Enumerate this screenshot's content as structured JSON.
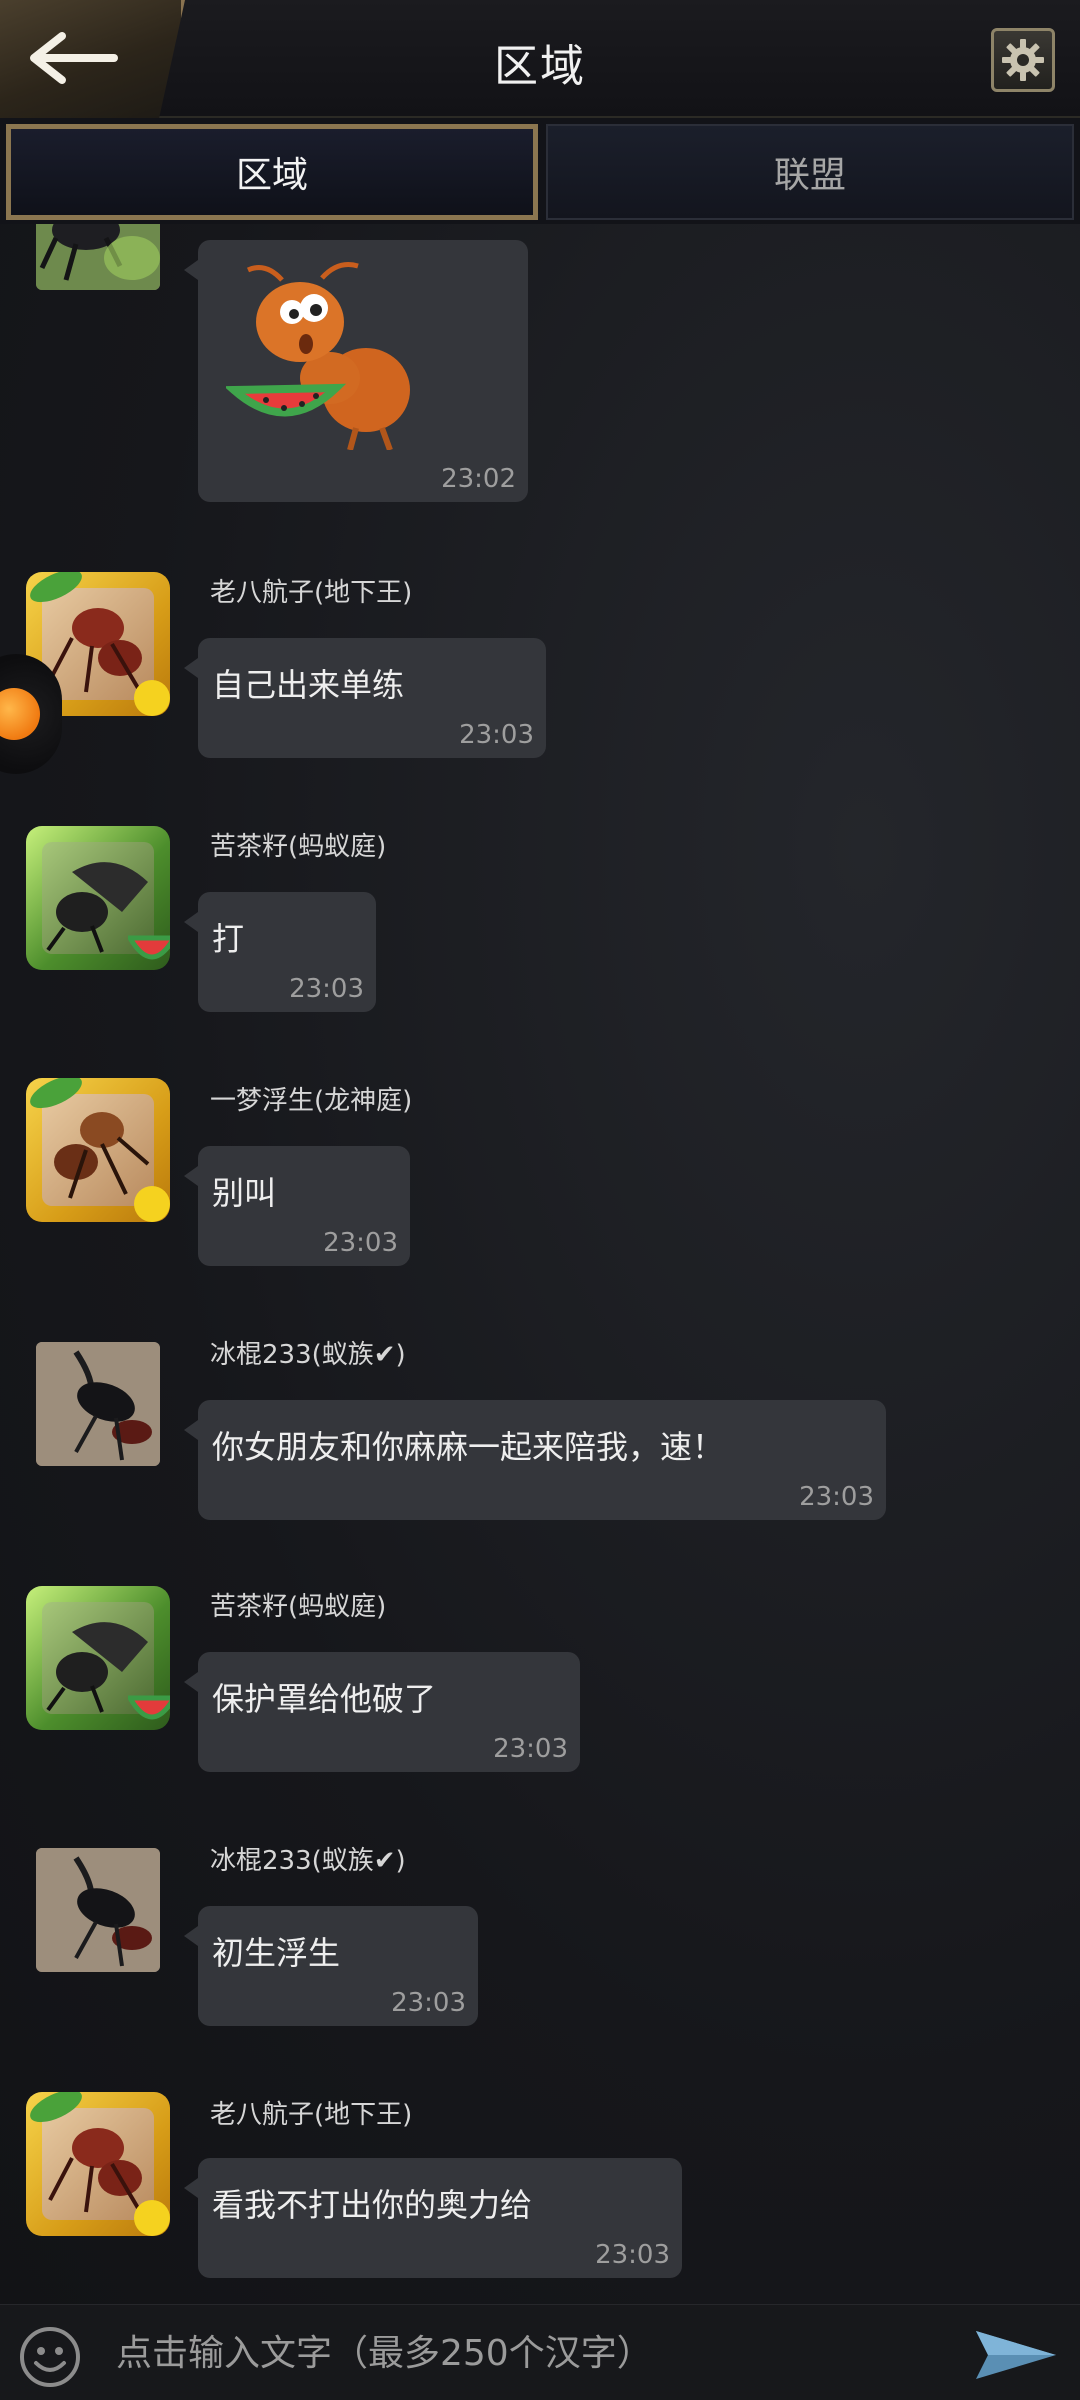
{
  "header": {
    "title": "区域",
    "back_icon": "back-arrow-icon",
    "settings_icon": "gear-icon"
  },
  "tabs": [
    {
      "label": "区域",
      "active": true
    },
    {
      "label": "联盟",
      "active": false
    }
  ],
  "messages": [
    {
      "sender": "",
      "type": "sticker",
      "sticker": "ant-eating-watermelon",
      "time": "23:02",
      "avatar": "beetle"
    },
    {
      "sender": "老八航子(地下王)",
      "text": "自己出来单练",
      "time": "23:03",
      "avatar": "gold-ant"
    },
    {
      "sender": "苦茶籽(蚂蚁庭)",
      "text": "打",
      "time": "23:03",
      "avatar": "green-bug"
    },
    {
      "sender": "一梦浮生(龙神庭)",
      "text": "别叫",
      "time": "23:03",
      "avatar": "gold-ant"
    },
    {
      "sender": "冰棍233(蚁族✔)",
      "text": "你女朋友和你麻麻一起来陪我，速！",
      "time": "23:03",
      "avatar": "beetle"
    },
    {
      "sender": "苦茶籽(蚂蚁庭)",
      "text": "保护罩给他破了",
      "time": "23:03",
      "avatar": "green-bug"
    },
    {
      "sender": "冰棍233(蚁族✔)",
      "text": "初生浮生",
      "time": "23:03",
      "avatar": "beetle"
    },
    {
      "sender": "老八航子(地下王)",
      "text": "看我不打出你的奥力给",
      "time": "23:03",
      "avatar": "gold-ant"
    }
  ],
  "input": {
    "placeholder": "点击输入文字（最多250个汉字）",
    "emoji_icon": "emoji-icon",
    "send_icon": "send-icon"
  },
  "colors": {
    "bubble": "#34363b",
    "gold_border": "#8b7650",
    "background": "#15161a"
  }
}
